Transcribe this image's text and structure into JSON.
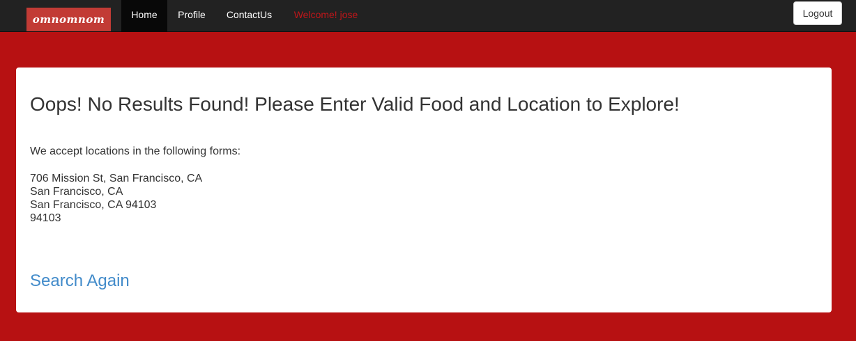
{
  "navbar": {
    "brand": "omnomnom",
    "items": [
      {
        "label": "Home"
      },
      {
        "label": "Profile"
      },
      {
        "label": "ContactUs"
      }
    ],
    "welcome": "Welcome! jose",
    "logout_label": "Logout"
  },
  "main": {
    "headline": "Oops! No Results Found! Please Enter Valid Food and Location to Explore!",
    "intro": "We accept locations in the following forms:",
    "examples": [
      "706 Mission St, San Francisco, CA",
      "San Francisco, CA",
      "San Francisco, CA 94103",
      "94103"
    ],
    "search_again": "Search Again"
  },
  "colors": {
    "page_background": "#b71112",
    "navbar": "#222222",
    "brand_background": "#c23b35",
    "welcome_text": "#c0161a",
    "link": "#428bca"
  }
}
